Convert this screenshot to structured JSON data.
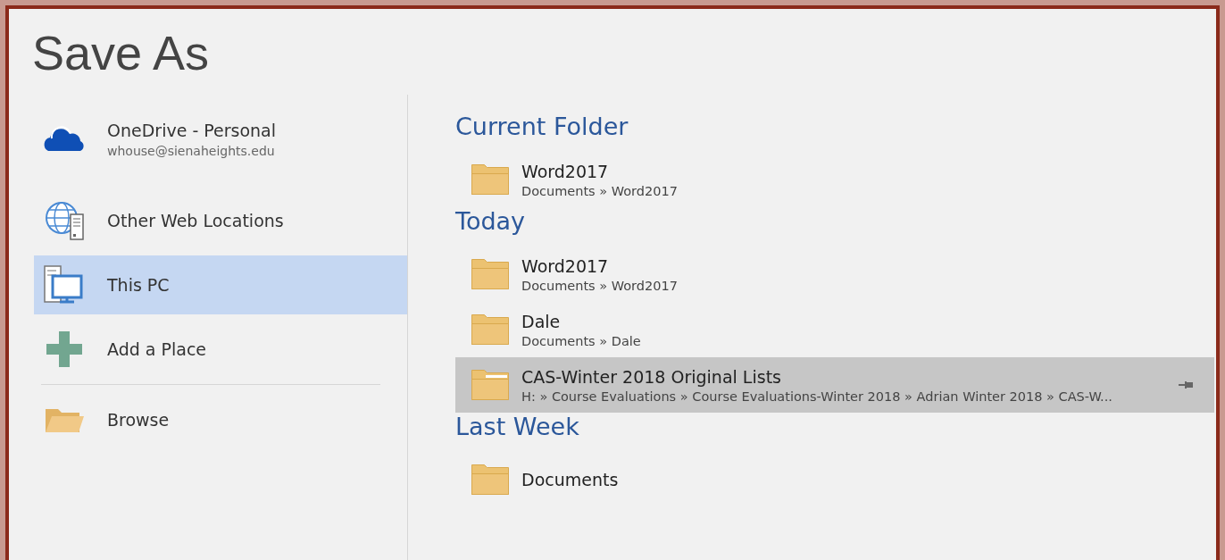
{
  "title": "Save As",
  "places": [
    {
      "kind": "onedrive",
      "label": "OneDrive - Personal",
      "sublabel": "whouse@sienaheights.edu",
      "selected": false
    },
    {
      "kind": "web",
      "label": "Other Web Locations",
      "selected": false
    },
    {
      "kind": "pc",
      "label": "This PC",
      "selected": true
    },
    {
      "kind": "add",
      "label": "Add a Place",
      "selected": false
    },
    {
      "kind": "browse",
      "label": "Browse",
      "selected": false
    }
  ],
  "sections": [
    {
      "heading": "Current Folder",
      "items": [
        {
          "name": "Word2017",
          "path": "Documents » Word2017",
          "selected": false
        }
      ]
    },
    {
      "heading": "Today",
      "items": [
        {
          "name": "Word2017",
          "path": "Documents » Word2017",
          "selected": false
        },
        {
          "name": "Dale",
          "path": "Documents » Dale",
          "selected": false
        },
        {
          "name": "CAS-Winter 2018 Original Lists",
          "path": "H: » Course Evaluations » Course Evaluations-Winter 2018 » Adrian Winter 2018 » CAS-W...",
          "selected": true
        }
      ]
    },
    {
      "heading": "Last Week",
      "items": [
        {
          "name": "Documents",
          "selected": false
        }
      ]
    }
  ]
}
